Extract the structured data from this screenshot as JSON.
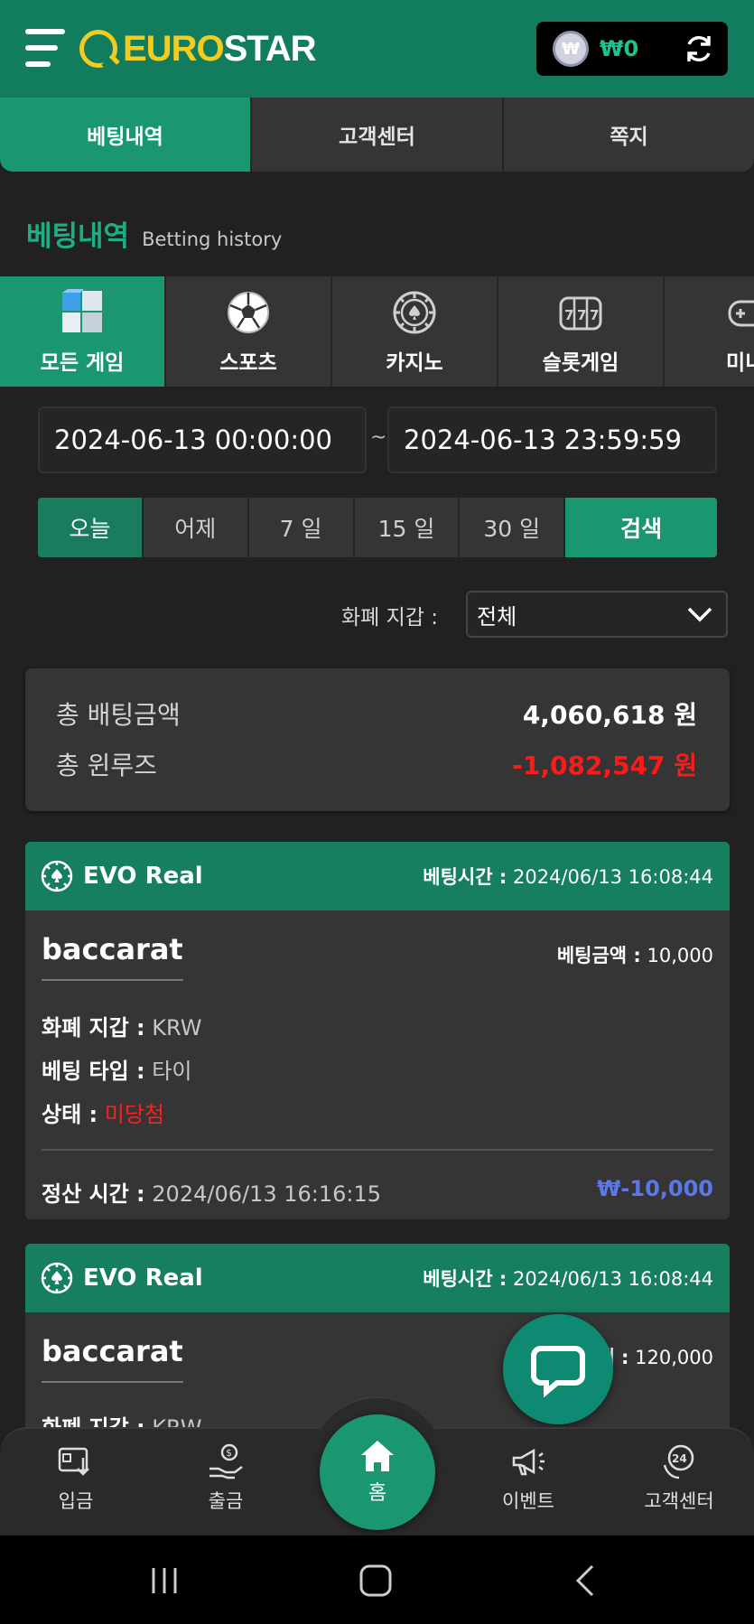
{
  "header": {
    "logo_euro": "EURO",
    "logo_star": "STAR",
    "currency_symbol": "₩",
    "balance": "₩0"
  },
  "top_tabs": [
    {
      "label": "베팅내역",
      "active": true
    },
    {
      "label": "고객센터",
      "active": false
    },
    {
      "label": "쪽지",
      "active": false
    }
  ],
  "page_title": {
    "ko": "베팅내역",
    "en": "Betting history"
  },
  "categories": [
    {
      "label": "모든 게임",
      "icon": "cubes-icon",
      "active": true
    },
    {
      "label": "스포츠",
      "icon": "soccer-ball-icon",
      "active": false
    },
    {
      "label": "카지노",
      "icon": "casino-chip-icon",
      "active": false
    },
    {
      "label": "슬롯게임",
      "icon": "slot-machine-icon",
      "active": false
    },
    {
      "label": "미니",
      "icon": "gamepad-icon",
      "active": false
    }
  ],
  "date_range": {
    "start": "2024-06-13 00:00:00",
    "separator": "~",
    "end": "2024-06-13 23:59:59"
  },
  "quick_ranges": [
    {
      "label": "오늘",
      "active": true
    },
    {
      "label": "어제",
      "active": false
    },
    {
      "label": "7 일",
      "active": false
    },
    {
      "label": "15 일",
      "active": false
    },
    {
      "label": "30 일",
      "active": false
    }
  ],
  "search_label": "검색",
  "currency_filter": {
    "label": "화폐 지갑 :",
    "value": "전체"
  },
  "totals": {
    "bet_label": "총 배팅금액",
    "bet_value": "4,060,618 원",
    "winloss_label": "총 윈루즈",
    "winloss_value": "-1,082,547 원"
  },
  "bets": [
    {
      "provider": "EVO Real",
      "time_label": "베팅시간 :",
      "time_value": "2024/06/13 16:08:44",
      "game": "baccarat",
      "amount_label": "베팅금액 :",
      "amount_value": "10,000",
      "wallet_label": "화폐 지갑 :",
      "wallet_value": "KRW",
      "type_label": "베팅 타입 :",
      "type_value": "타이",
      "status_label": "상태 :",
      "status_value": "미당첨",
      "settle_label": "정산 시간 :",
      "settle_value": "2024/06/13 16:16:15",
      "payout": "₩-10,000"
    },
    {
      "provider": "EVO Real",
      "time_label": "베팅시간 :",
      "time_value": "2024/06/13 16:08:44",
      "game": "baccarat",
      "amount_label": "베팅금액 :",
      "amount_value": "120,000",
      "wallet_label": "화폐 지갑 :",
      "wallet_value": "KRW"
    }
  ],
  "bottom_nav": [
    {
      "label": "입금",
      "icon": "deposit-icon"
    },
    {
      "label": "출금",
      "icon": "withdraw-icon"
    },
    {
      "label": "홈",
      "icon": "home-icon"
    },
    {
      "label": "이벤트",
      "icon": "megaphone-icon"
    },
    {
      "label": "고객센터",
      "icon": "support-24-icon"
    }
  ],
  "colors": {
    "brand_green": "#1a9771",
    "header_green": "#127c5e",
    "logo_yellow": "#f4cc1d",
    "negative_red": "#ff1a1a",
    "payout_blue": "#5b78e8"
  }
}
